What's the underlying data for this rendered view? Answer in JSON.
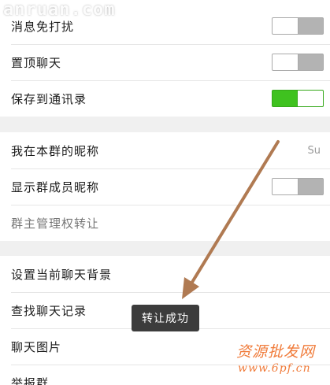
{
  "settings": {
    "mute": {
      "label": "消息免打扰",
      "on": false
    },
    "pin": {
      "label": "置顶聊天",
      "on": false
    },
    "save_contacts": {
      "label": "保存到通讯录",
      "on": true
    },
    "my_nickname": {
      "label": "我在本群的昵称",
      "value": "Su"
    },
    "show_nickname": {
      "label": "显示群成员昵称",
      "on": false
    },
    "transfer_owner": {
      "label": "群主管理权转让"
    },
    "set_background": {
      "label": "设置当前聊天背景"
    },
    "find_history": {
      "label": "查找聊天记录"
    },
    "chat_images": {
      "label": "聊天图片"
    },
    "report": {
      "label": "举报群"
    }
  },
  "toast": {
    "text": "转让成功"
  },
  "watermarks": {
    "top": "anruan.com",
    "bottom_line1": "资源批发网",
    "bottom_line2": "www.6pf.cn"
  },
  "colors": {
    "toggle_on": "#3fc21f",
    "arrow": "#b07a52",
    "watermark_bottom": "#f07b3a"
  }
}
